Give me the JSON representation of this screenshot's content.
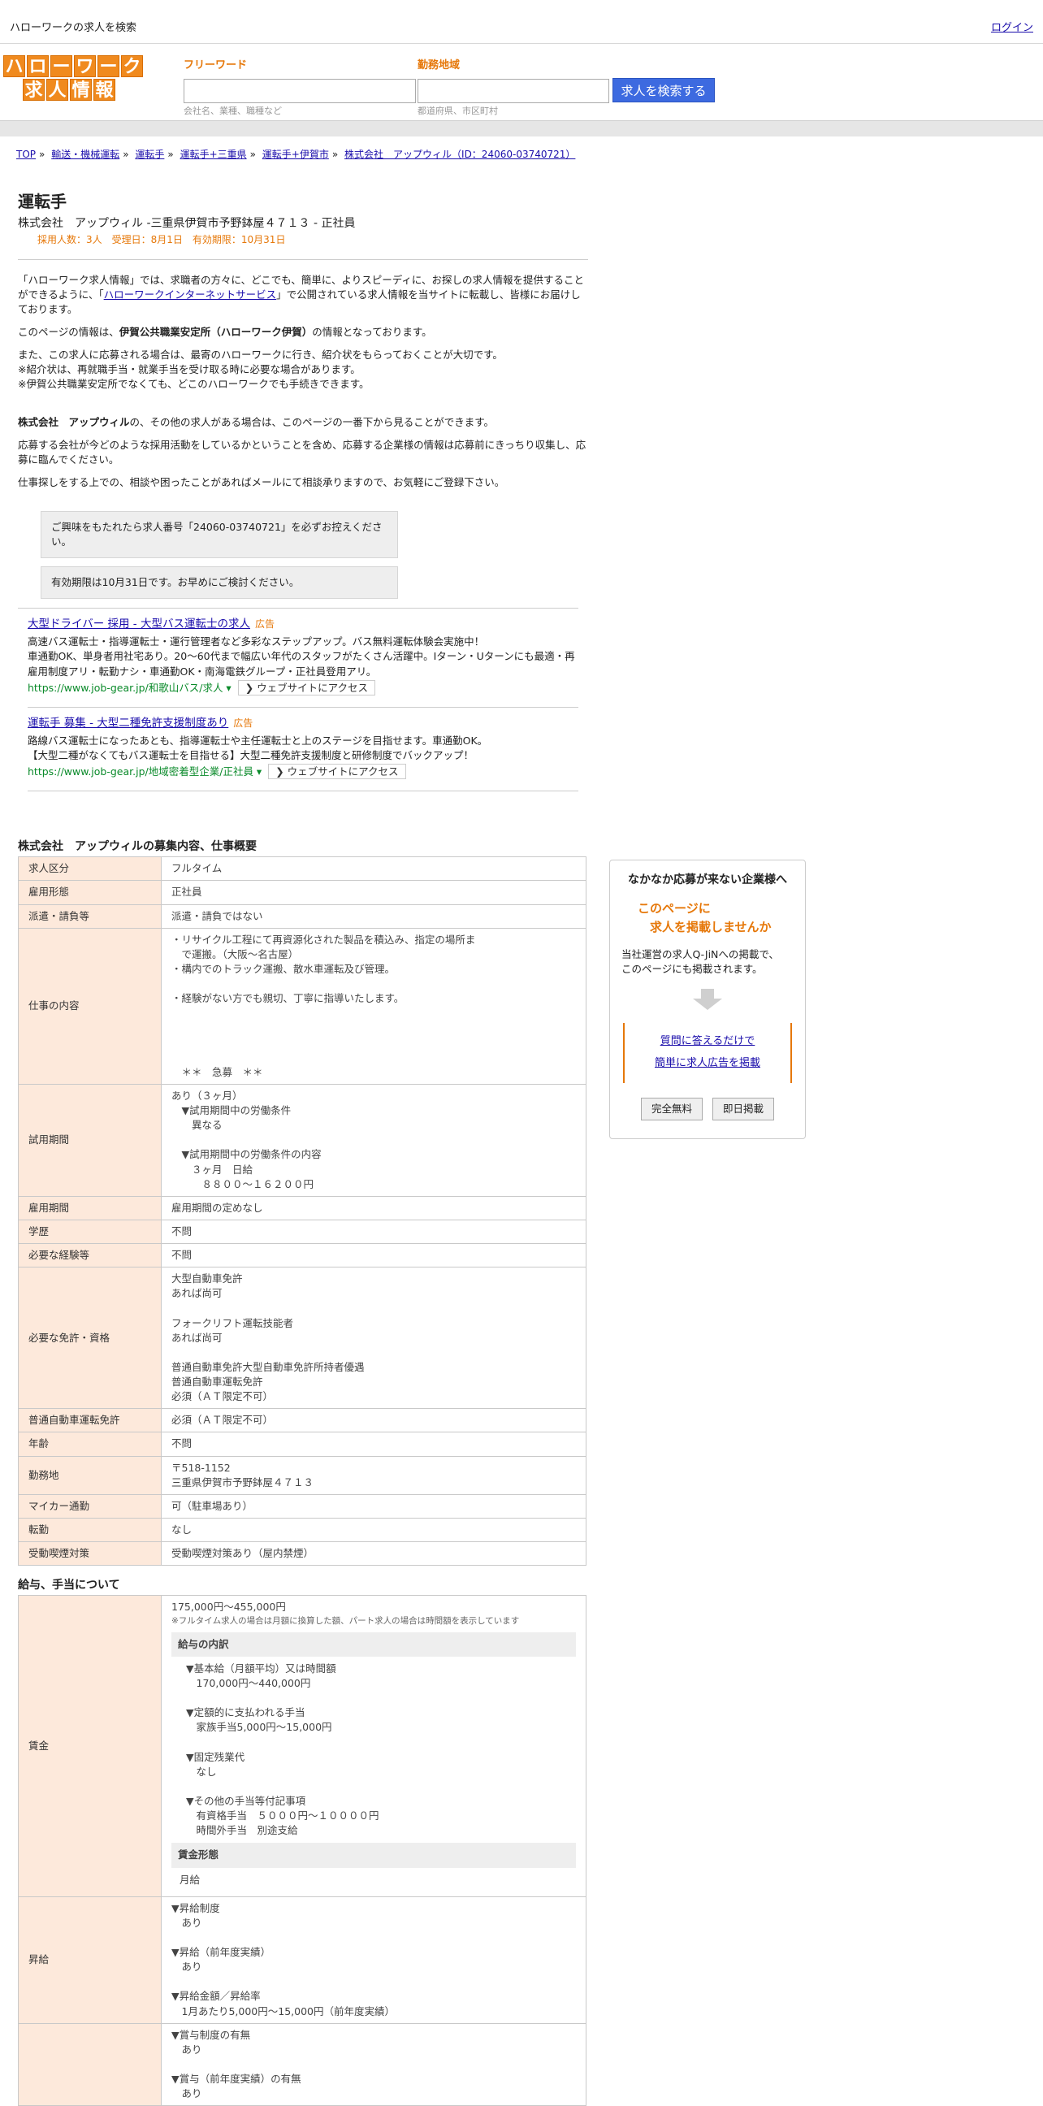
{
  "topbar": {
    "site_title": "ハローワークの求人を検索",
    "login": "ログイン"
  },
  "logo": {
    "row1": [
      "ハ",
      "ロ",
      "ー",
      "ワ",
      "ー",
      "ク"
    ],
    "row2": [
      "求",
      "人",
      "情",
      "報"
    ]
  },
  "search": {
    "freeword_label": "フリーワード",
    "freeword_hint": "会社名、業種、職種など",
    "area_label": "勤務地域",
    "area_hint": "都道府県、市区町村",
    "button": "求人を検索する"
  },
  "breadcrumb": [
    "TOP",
    "輸送・機械運転",
    "運転手",
    "運転手+三重県",
    "運転手+伊賀市",
    "株式会社　アップウィル（ID：24060-03740721）"
  ],
  "job": {
    "title": "運転手",
    "subtitle": "株式会社　アップウィル -三重県伊賀市予野鉢屋４７１３ - 正社員",
    "meta": "採用人数：3人　受理日：8月1日　有効期限：10月31日"
  },
  "intro": {
    "p1_pre": "「ハローワーク求人情報」では、求職者の方々に、どこでも、簡単に、よりスピーディに、お探しの求人情報を提供することができるように、「",
    "p1_link": "ハローワークインターネットサービス",
    "p1_post": "」で公開されている求人情報を当サイトに転載し、皆様にお届けしております。",
    "p2_pre": "このページの情報は、",
    "p2_bold": "伊賀公共職業安定所（ハローワーク伊賀）",
    "p2_post": "の情報となっております。",
    "p3": "また、この求人に応募される場合は、最寄のハローワークに行き、紹介状をもらっておくことが大切です。\n※紹介状は、再就職手当・就業手当を受け取る時に必要な場合があります。\n※伊賀公共職業安定所でなくても、どこのハローワークでも手続きできます。",
    "p4_bold": "株式会社　アップウィル",
    "p4_post": "の、その他の求人がある場合は、このページの一番下から見ることができます。",
    "p5": "応募する会社が今どのような採用活動をしているかということを含め、応募する企業様の情報は応募前にきっちり収集し、応募に臨んでください。",
    "p6": "仕事探しをする上での、相談や困ったことがあればメールにて相談承りますので、お気軽にご登録下さい。"
  },
  "notices": [
    "ご興味をもたれたら求人番号「24060-03740721」を必ずお控えください。",
    "有効期限は10月31日です。お早めにご検討ください。"
  ],
  "ads": [
    {
      "title": "大型ドライバー 採用 - 大型バス運転士の求人",
      "tag": "広告",
      "desc": "高速バス運転士・指導運転士・運行管理者など多彩なステップアップ。バス無料運転体験会実施中！\n車通勤OK、単身者用社宅あり。20～60代まで幅広い年代のスタッフがたくさん活躍中。Iターン・Uターンにも最適・再雇用制度アリ・転勤ナシ・車通勤OK・南海電鉄グループ・正社員登用アリ。",
      "url": "https://www.job-gear.jp/和歌山バス/求人",
      "button": "❯ ウェブサイトにアクセス"
    },
    {
      "title": "運転手 募集 - 大型二種免許支援制度あり",
      "tag": "広告",
      "desc": "路線バス運転士になったあとも、指導運転士や主任運転士と上のステージを目指せます。車通勤OK。\n【大型二種がなくてもバス運転士を目指せる】大型二種免許支援制度と研修制度でバックアップ！",
      "url": "https://www.job-gear.jp/地域密着型企業/正社員",
      "button": "❯ ウェブサイトにアクセス"
    }
  ],
  "overview": {
    "heading": "株式会社　アップウィルの募集内容、仕事概要",
    "rows": [
      {
        "k": "求人区分",
        "v": "フルタイム"
      },
      {
        "k": "雇用形態",
        "v": "正社員"
      },
      {
        "k": "派遣・請負等",
        "v": "派遣・請負ではない"
      },
      {
        "k": "仕事の内容",
        "v": "・リサイクル工程にて再資源化された製品を積込み、指定の場所ま\n　で運搬。（大阪～名古屋）\n・構内でのトラック運搬、散水車運転及び管理。\n\n・経験がない方でも親切、丁寧に指導いたします。\n\n\n\n\n　＊＊　急募　＊＊"
      },
      {
        "k": "試用期間",
        "v": "あり（３ヶ月）\n　▼試用期間中の労働条件\n　　異なる\n\n　▼試用期間中の労働条件の内容\n　　３ヶ月　日給\n　　　８８００～１６２００円"
      },
      {
        "k": "雇用期間",
        "v": "雇用期間の定めなし"
      },
      {
        "k": "学歴",
        "v": "不問"
      },
      {
        "k": "必要な経験等",
        "v": "不問"
      },
      {
        "k": "必要な免許・資格",
        "v": "大型自動車免許\nあれば尚可\n\nフォークリフト運転技能者\nあれば尚可\n\n普通自動車免許大型自動車免許所持者優遇\n普通自動車運転免許\n必須（ＡＴ限定不可）"
      },
      {
        "k": "普通自動車運転免許",
        "v": "必須（ＡＴ限定不可）"
      },
      {
        "k": "年齢",
        "v": "不問"
      },
      {
        "k": "勤務地",
        "v": "〒518-1152\n三重県伊賀市予野鉢屋４７１３"
      },
      {
        "k": "マイカー通勤",
        "v": "可（駐車場あり）"
      },
      {
        "k": "転勤",
        "v": "なし"
      },
      {
        "k": "受動喫煙対策",
        "v": "受動喫煙対策あり（屋内禁煙）"
      }
    ]
  },
  "salary": {
    "heading": "給与、手当について",
    "wage_label": "賃金",
    "wage_range": "175,000円〜455,000円",
    "wage_note": "※フルタイム求人の場合は月額に換算した額、パート求人の場合は時間額を表示しています",
    "breakdown_head": "給与の内訳",
    "breakdown": "▼基本給（月額平均）又は時間額\n　170,000円〜440,000円\n\n▼定額的に支払われる手当\n　家族手当5,000円〜15,000円\n\n▼固定残業代\n　なし\n\n▼その他の手当等付記事項\n　有資格手当　５０００円～１００００円\n　時間外手当　別途支給",
    "form_head": "賃金形態",
    "form": "月給",
    "raise_label": "昇給",
    "raise": "▼昇給制度\n　あり\n\n▼昇給（前年度実績）\n　あり\n\n▼昇給金額／昇給率\n　1月あたり5,000円〜15,000円（前年度実績）",
    "bonus": "▼賞与制度の有無\n　あり\n\n▼賞与（前年度実績）の有無\n　あり"
  },
  "sidebox": {
    "title": "なかなか応募が来ない企業様へ",
    "orange": "このページに\n　求人を掲載しませんか",
    "text": "当社運営の求人Q-JiNへの掲載で、\nこのページにも掲載されます。",
    "link1": "質問に答えるだけで",
    "link2": "簡単に求人広告を掲載",
    "btn1": "完全無料",
    "btn2": "即日掲載"
  }
}
